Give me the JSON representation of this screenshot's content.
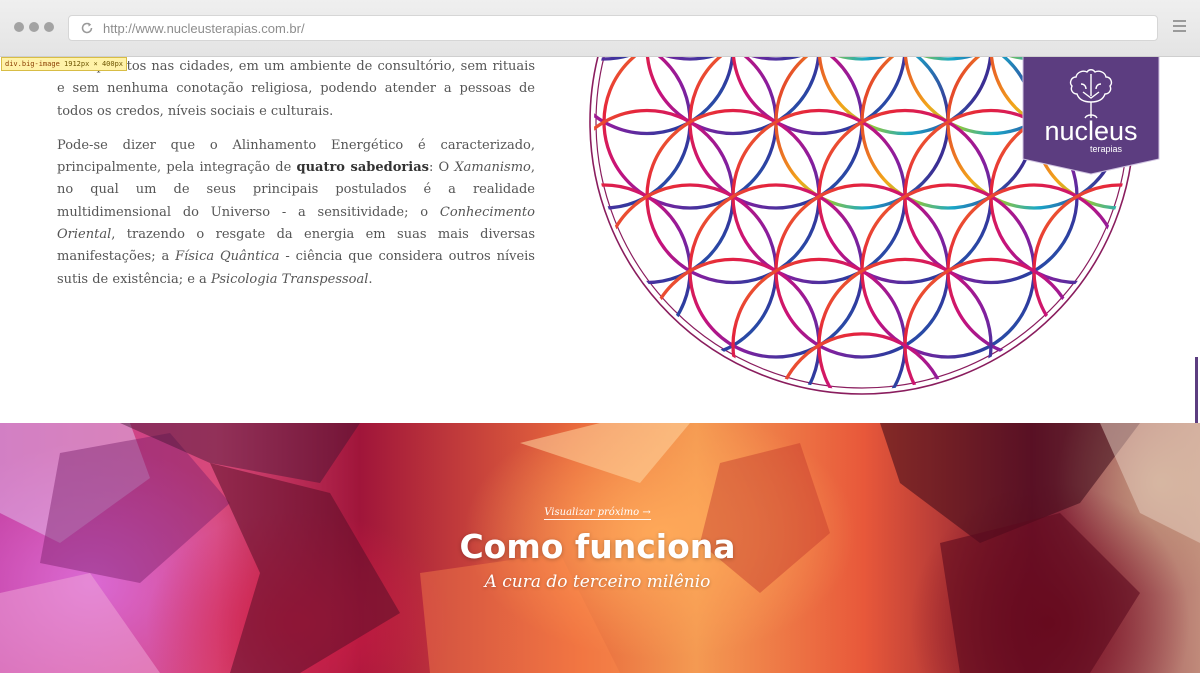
{
  "browser": {
    "url": "http://www.nucleusterapias.com.br/"
  },
  "devtools": {
    "element": "div.big-image",
    "size": "1912px × 400px"
  },
  "article": {
    "p1_start": "sem aparatos nas cidades, em um ambiente de consultório, sem rituais e sem nenhuma conotação religiosa, podendo atender a pessoas de todos os credos, níveis sociais e culturais.",
    "p2": {
      "t1": "Pode-se dizer que o Alinhamento Energético é caracterizado, principalmente, pela integração de ",
      "b1": "quatro sabedorias",
      "t2": ": O ",
      "i1": "Xamanismo",
      "t3": ", no qual um de seus principais postulados é a realidade multidimensional do Universo - a sensitividade; o ",
      "i2": "Conhecimento Oriental",
      "t4": ", trazendo o resgate da energia em suas mais diversas manifestações; a ",
      "i3": "Física Quântica",
      "t5": " - ciência que considera outros níveis sutis de existência; e a ",
      "i4": "Psicologia Transpessoal",
      "t6": "."
    }
  },
  "logo": {
    "name": "nucleus",
    "tagline": "terapias",
    "color": "#5c3d80"
  },
  "hero": {
    "next_link": "Visualizar próximo →",
    "title": "Como funciona",
    "subtitle": "A cura do terceiro milênio"
  }
}
